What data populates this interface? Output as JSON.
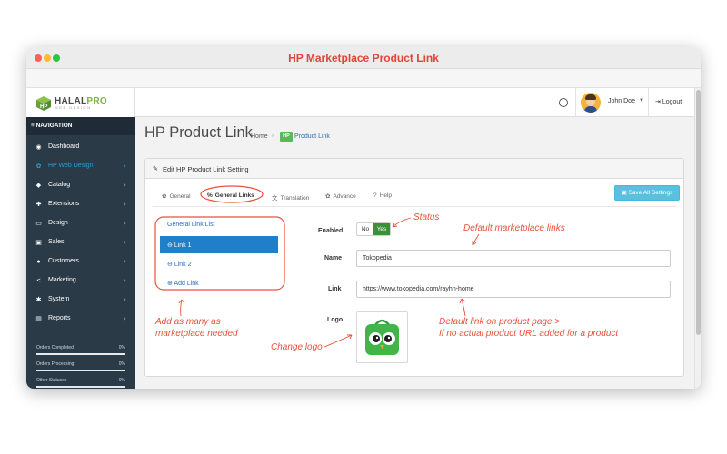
{
  "window": {
    "title": "HP Marketplace Product Link"
  },
  "brand": {
    "logo_main": "HALAL",
    "logo_accent": "PRO",
    "logo_sub": "WEB DESIGN"
  },
  "topbar": {
    "user_name": "John Doe",
    "logout_label": "Logout"
  },
  "sidebar": {
    "header": "NAVIGATION",
    "items": [
      {
        "label": "Dashboard",
        "icon": "dashboard-icon",
        "glyph": "◉",
        "chevron": ""
      },
      {
        "label": "HP Web Design",
        "icon": "gear-icon",
        "glyph": "✿",
        "chevron": "›"
      },
      {
        "label": "Catalog",
        "icon": "tag-icon",
        "glyph": "◆",
        "chevron": "›"
      },
      {
        "label": "Extensions",
        "icon": "puzzle-icon",
        "glyph": "✚",
        "chevron": "›"
      },
      {
        "label": "Design",
        "icon": "monitor-icon",
        "glyph": "▭",
        "chevron": "›"
      },
      {
        "label": "Sales",
        "icon": "cart-icon",
        "glyph": "▣",
        "chevron": "›"
      },
      {
        "label": "Customers",
        "icon": "user-icon",
        "glyph": "●",
        "chevron": "›"
      },
      {
        "label": "Marketing",
        "icon": "share-icon",
        "glyph": "<",
        "chevron": "›"
      },
      {
        "label": "System",
        "icon": "cog-icon",
        "glyph": "✱",
        "chevron": "›"
      },
      {
        "label": "Reports",
        "icon": "bar-chart-icon",
        "glyph": "▥",
        "chevron": "›"
      }
    ],
    "stats": [
      {
        "label": "Orders Completed",
        "percent": "0%"
      },
      {
        "label": "Orders Processing",
        "percent": "0%"
      },
      {
        "label": "Other Statuses",
        "percent": "0%"
      }
    ]
  },
  "page": {
    "title": "HP Product Link",
    "breadcrumb": {
      "home": "Home",
      "sep": "›",
      "badge": "HP",
      "current": "Product Link"
    }
  },
  "panel": {
    "title": "Edit HP Product Link Setting",
    "save_label": "Save All Settings",
    "tabs": [
      {
        "label": "General",
        "glyph": "✿"
      },
      {
        "label": "General Links",
        "glyph": "%"
      },
      {
        "label": "Translation",
        "glyph": "文"
      },
      {
        "label": "Advance",
        "glyph": "✿"
      },
      {
        "label": "Help",
        "glyph": "?"
      }
    ]
  },
  "link_list": {
    "title": "General Link List",
    "items": [
      "Link 1",
      "Link 2"
    ],
    "add_label": "Add Link"
  },
  "form": {
    "enabled_label": "Enabled",
    "toggle": {
      "no": "No",
      "yes": "Yes"
    },
    "name_label": "Name",
    "name_value": "Tokopedia",
    "link_label": "Link",
    "link_value": "https://www.tokopedia.com/rayhn-home",
    "logo_label": "Logo"
  },
  "annotations": {
    "status": "Status",
    "default_links": "Default marketplace links",
    "add_many_1": "Add as many as",
    "add_many_2": "marketplace needed",
    "default_link_1": "Default link on product page >",
    "default_link_2": "If no actual product URL added for a product",
    "change_logo": "Change logo"
  },
  "colors": {
    "accent_red": "#e8513d",
    "sidebar_bg": "#2b3a47",
    "active_blue": "#1f7fc8",
    "toggle_green": "#3d8f3a",
    "save_button": "#5bc0de"
  }
}
